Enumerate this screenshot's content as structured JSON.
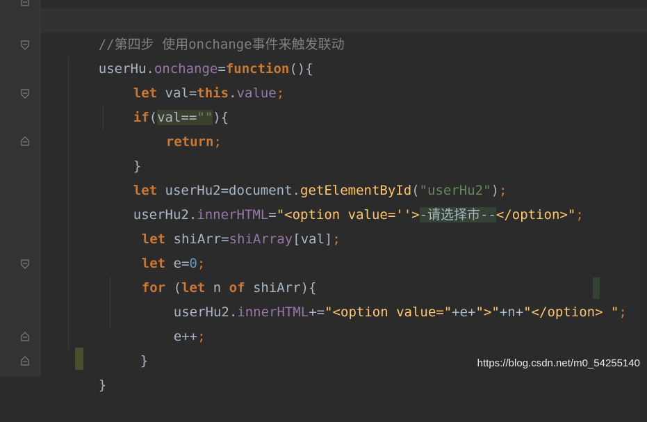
{
  "colors": {
    "background": "#2b2b2b",
    "gutter": "#313335",
    "keyword": "#cc7832",
    "property": "#9876aa",
    "function": "#ffc66d",
    "string": "#6a8759",
    "number": "#6897bb",
    "comment": "#808080",
    "plain": "#a9b7c6"
  },
  "code": {
    "l1": {
      "comment": "//第四步 使用onchange事件来触发联动"
    },
    "l2": {
      "obj": "userHu.",
      "prop": "onchange",
      "eq": "=",
      "kw": "function",
      "rest": "(){"
    },
    "l3": {
      "kw1": "let",
      "a": " val=",
      "kw2": "this",
      "dot": ".",
      "prop": "value",
      "semi": ";"
    },
    "l4": {
      "kw": "if",
      "open": "(",
      "cond": "val==",
      "str": "\"\"",
      "close": "){"
    },
    "l5": {
      "kw": "return",
      "semi": ";"
    },
    "l6": {
      "brace": "}"
    },
    "l7": {
      "kw": "let",
      "a": " userHu2=document.",
      "fn": "getElementById",
      "open": "(",
      "str": "\"userHu2\"",
      "close": ")",
      "semi": ";"
    },
    "l8": {
      "obj": "userHu2.",
      "prop": "innerHTML",
      "eq": "=",
      "str1": "\"<option value=''>",
      "str2": "-请选择市--",
      "str3": "</option>\"",
      "semi": ";"
    },
    "l9": {
      "kw": "let",
      "a": " shiArr=",
      "prop": "shiArray",
      "b": "[val]",
      "semi": ";"
    },
    "l10": {
      "kw": "let",
      "a": " e=",
      "num": "0",
      "semi": ";"
    },
    "l11": {
      "kw1": "for",
      "a": " (",
      "kw2": "let",
      "b": " n ",
      "kw3": "of",
      "c": " shiArr){"
    },
    "l12": {
      "obj": "userHu2.",
      "prop": "innerHTML",
      "op": "+=",
      "s1": "\"<option value=\"",
      "p1": "+e+",
      "s2": "\">\"",
      "p2": "+n+",
      "s3": "\"</option>",
      "s4": " \"",
      "semi": ";"
    },
    "l13": {
      "a": "e++",
      "semi": ";"
    },
    "l14": {
      "brace": "}"
    },
    "l15": {
      "brace": "}"
    }
  },
  "watermark": "https://blog.csdn.net/m0_54255140"
}
